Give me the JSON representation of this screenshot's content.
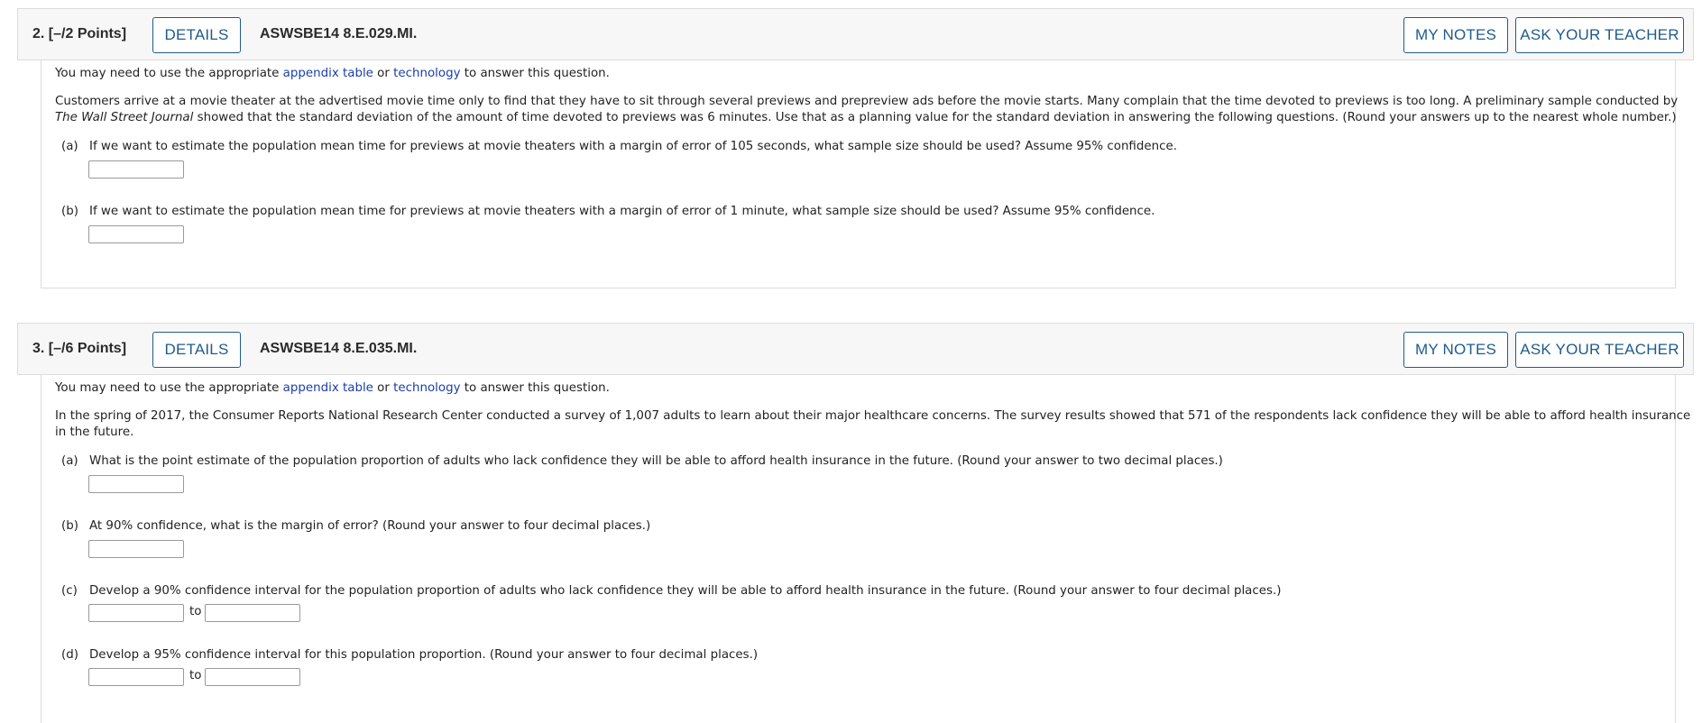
{
  "questions": [
    {
      "number": "2.",
      "points": "[–/2 Points]",
      "details_label": "DETAILS",
      "code": "ASWSBE14 8.E.029.MI.",
      "my_notes_label": "MY NOTES",
      "ask_teacher_label": "ASK YOUR TEACHER",
      "intro": {
        "prefix": "You may need to use the appropriate ",
        "link1": "appendix table",
        "middle": " or ",
        "link2": "technology",
        "suffix": " to answer this question."
      },
      "stem_line1": "Customers arrive at a movie theater at the advertised movie time only to find that they have to sit through several previews and prepreview ads before the movie starts. Many complain that the time devoted to previews is too long. A preliminary sample conducted by",
      "stem_italic": "The Wall Street Journal",
      "stem_line2": " showed that the standard deviation of the amount of time devoted to previews was 6 minutes. Use that as a planning value for the standard deviation in answering the following questions. (Round your answers up to the nearest whole number.)",
      "parts": [
        {
          "label": "(a)",
          "text": "If we want to estimate the population mean time for previews at movie theaters with a margin of error of 105 seconds, what sample size should be used? Assume 95% confidence.",
          "value": ""
        },
        {
          "label": "(b)",
          "text": "If we want to estimate the population mean time for previews at movie theaters with a margin of error of 1 minute, what sample size should be used? Assume 95% confidence.",
          "value": ""
        }
      ]
    },
    {
      "number": "3.",
      "points": "[–/6 Points]",
      "details_label": "DETAILS",
      "code": "ASWSBE14 8.E.035.MI.",
      "my_notes_label": "MY NOTES",
      "ask_teacher_label": "ASK YOUR TEACHER",
      "intro": {
        "prefix": "You may need to use the appropriate ",
        "link1": "appendix table",
        "middle": " or ",
        "link2": "technology",
        "suffix": " to answer this question."
      },
      "stem_line1": "In the spring of 2017, the Consumer Reports National Research Center conducted a survey of 1,007 adults to learn about their major healthcare concerns. The survey results showed that 571 of the respondents lack confidence they will be able to afford health insurance",
      "stem_line2": "in the future.",
      "parts": [
        {
          "label": "(a)",
          "text": "What is the point estimate of the population proportion of adults who lack confidence they will be able to afford health insurance in the future. (Round your answer to two decimal places.)",
          "value": ""
        },
        {
          "label": "(b)",
          "text": "At 90% confidence, what is the margin of error? (Round your answer to four decimal places.)",
          "value": ""
        },
        {
          "label": "(c)",
          "text": "Develop a 90% confidence interval for the population proportion of adults who lack confidence they will be able to afford health insurance in the future. (Round your answer to four decimal places.)",
          "to_label": "to",
          "low": "",
          "high": ""
        },
        {
          "label": "(d)",
          "text": "Develop a 95% confidence interval for this population proportion. (Round your answer to four decimal places.)",
          "to_label": "to",
          "low": "",
          "high": ""
        }
      ]
    }
  ]
}
